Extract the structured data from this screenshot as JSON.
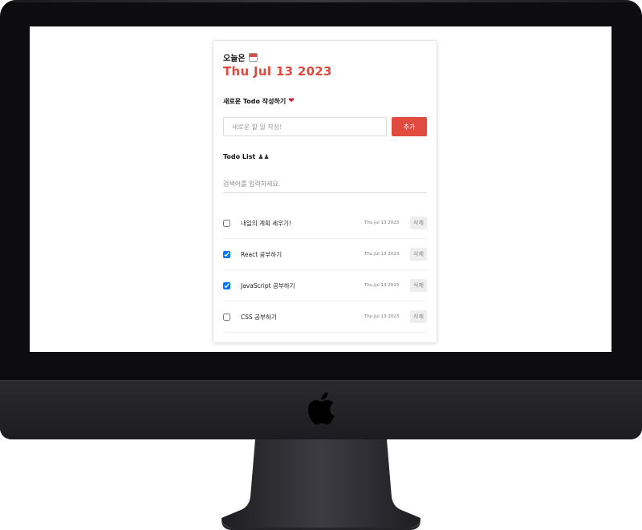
{
  "app": {
    "today_label": "오늘은",
    "date": "Thu Jul 13 2023"
  },
  "editor": {
    "title": "새로운 Todo 작성하기",
    "placeholder": "새로운 할 일 작성!",
    "add_label": "추가"
  },
  "list": {
    "title": "Todo List",
    "search_placeholder": "검색어를 입력하세요.",
    "delete_label": "삭제",
    "items": [
      {
        "text": "내일의 계획 세우기!",
        "date": "Thu Jul 13 2023",
        "done": false
      },
      {
        "text": "React 공부하기",
        "date": "Thu Jul 13 2023",
        "done": true
      },
      {
        "text": "JavaScript 공부하기",
        "date": "Thu Jul 13 2023",
        "done": true
      },
      {
        "text": "CSS 공부하기",
        "date": "Thu Jul 13 2023",
        "done": false
      }
    ]
  },
  "icons": {
    "calendar": "calendar-icon",
    "heart": "heart-icon",
    "people": "people-icon",
    "apple": "apple-logo"
  },
  "colors": {
    "accent": "#e04a3f",
    "device_frame": "#0d0d0f"
  }
}
